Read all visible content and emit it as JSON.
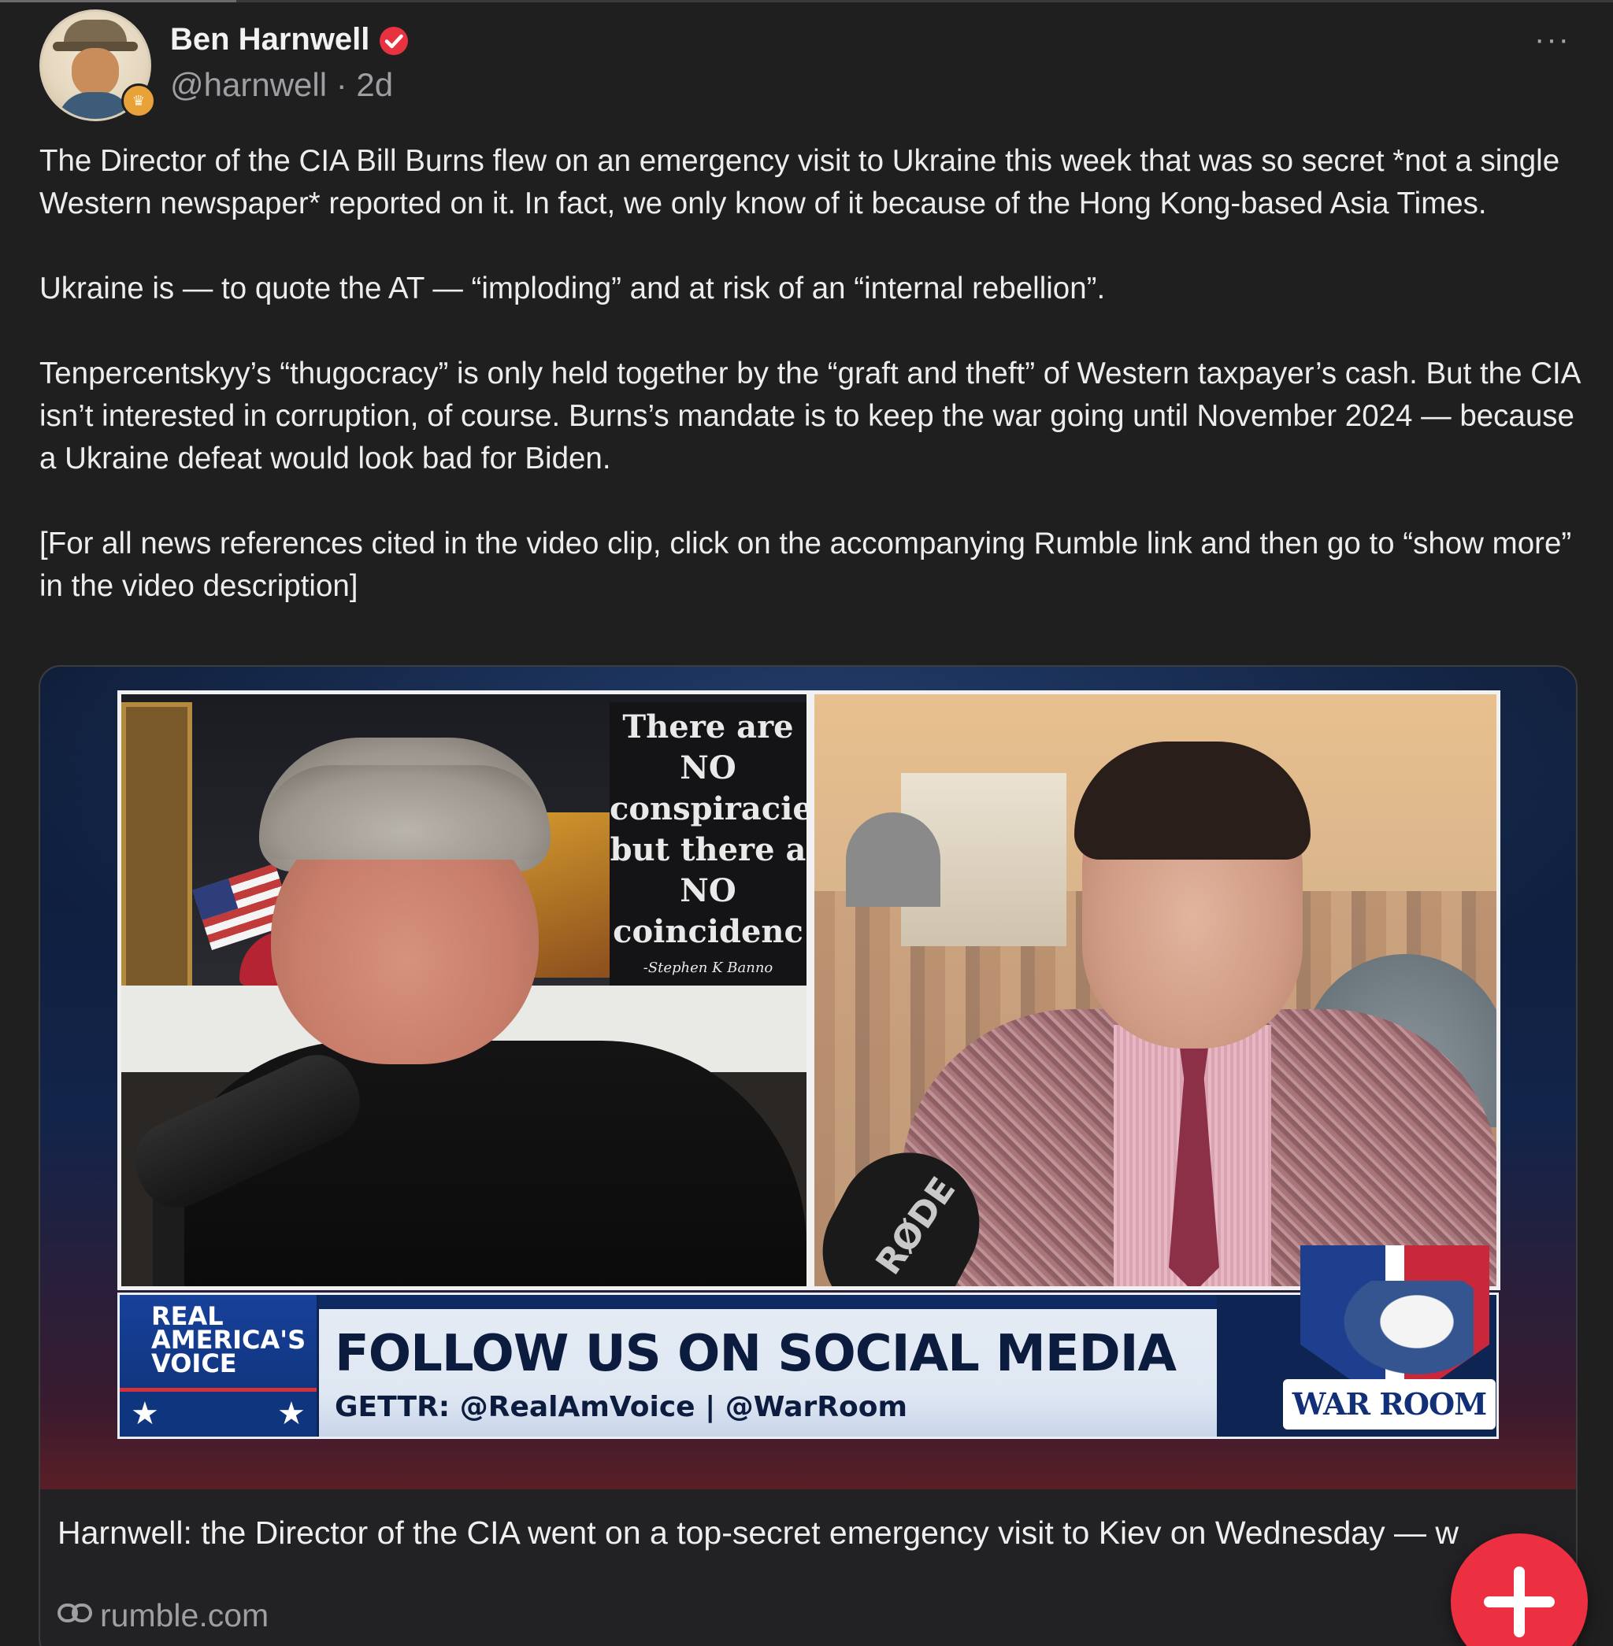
{
  "author": {
    "name": "Ben Harnwell",
    "handle": "@harnwell",
    "separator": "·",
    "age": "2d",
    "verified_color": "#e8323f"
  },
  "menu": {
    "more_label": "···"
  },
  "post": {
    "paragraphs": [
      "The Director of the CIA Bill Burns flew on an emergency visit to Ukraine this week that was so secret *not a single Western newspaper* reported on it. In fact, we only know of it because of the Hong Kong-based Asia Times.",
      "Ukraine is — to quote the AT — “imploding” and at risk of an “internal rebellion”.",
      "Tenpercentskyy’s “thugocracy” is only held together by the “graft and theft” of Western taxpayer’s cash. But the CIA isn’t interested in corruption, of course. Burns’s mandate is to keep the war going until November 2024 — because a Ukraine defeat would look bad for Biden.",
      "[For all news references cited in the video clip, click on the accompanying Rumble link and then go to “show more” in the video description]"
    ]
  },
  "video": {
    "sign_lines": [
      "There are",
      "NO",
      "conspiracie",
      "but there a",
      "NO",
      "coincidenc"
    ],
    "sign_signature": "-Stephen K Banno",
    "mic_brand": "RØDE",
    "network_logo": [
      "REAL",
      "AMERICA'S",
      "VOICE"
    ],
    "banner_title": "FOLLOW US ON SOCIAL MEDIA",
    "banner_sub": "GETTR: @RealAmVoice | @WarRoom",
    "show_logo": "WAR ROOM"
  },
  "card": {
    "title": "Harnwell: the Director of the CIA went on a top-secret emergency visit to Kiev on Wednesday — w",
    "domain": "rumble.com",
    "link_icon": "link-icon"
  },
  "fab": {
    "icon": "plus-icon",
    "color": "#ec3042"
  }
}
